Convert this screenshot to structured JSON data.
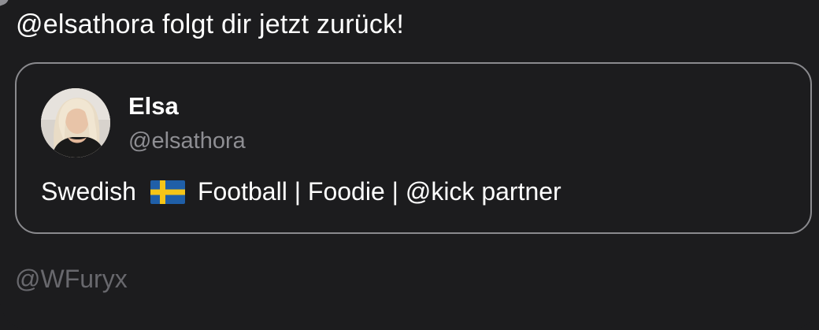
{
  "notification": {
    "text": "@elsathora folgt dir jetzt zurück!"
  },
  "profile_card": {
    "display_name": "Elsa",
    "username": "@elsathora",
    "bio_before_flag": "Swedish",
    "flag_icon": "sweden-flag-icon",
    "bio_after_flag": "Football | Foodie | @kick partner"
  },
  "watermark": {
    "text": "@WFuryx"
  },
  "colors": {
    "background": "#1c1c1e",
    "card_border": "#8a8a8e",
    "secondary_text": "#8e8e93",
    "watermark_text": "#68686d",
    "flag_blue": "#1f5fa8",
    "flag_yellow": "#f5c518"
  }
}
